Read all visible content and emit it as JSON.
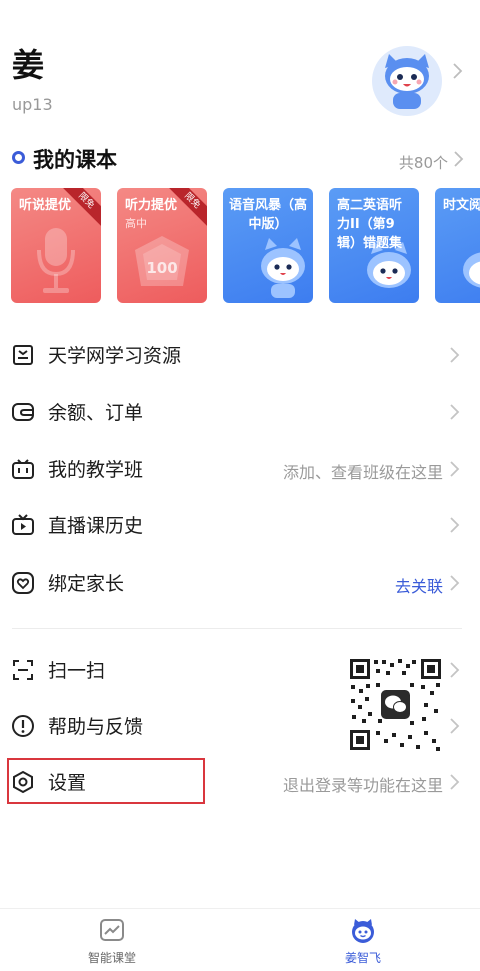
{
  "profile": {
    "name": "姜",
    "uid": "up13"
  },
  "textbooks": {
    "title": "我的课本",
    "count": "共80个",
    "items": [
      {
        "title": "听说提优",
        "subtitle": "",
        "badge": "限免",
        "color": "red"
      },
      {
        "title": "听力提优",
        "subtitle": "高中",
        "badge": "限免",
        "color": "red"
      },
      {
        "title": "语音风暴（高中版）",
        "subtitle": "",
        "badge": "",
        "color": "blue"
      },
      {
        "title": "高二英语听力II（第9辑）错题集",
        "subtitle": "",
        "badge": "",
        "color": "blue"
      },
      {
        "title": "时文阅",
        "subtitle": "",
        "badge": "",
        "color": "blue"
      }
    ],
    "score_badge": "100"
  },
  "menu": {
    "resources": {
      "label": "天学网学习资源",
      "icon": "smile-box-icon"
    },
    "orders": {
      "label": "余额、订单",
      "icon": "wallet-icon"
    },
    "classes": {
      "label": "我的教学班",
      "hint": "添加、查看班级在这里",
      "icon": "class-icon"
    },
    "live": {
      "label": "直播课历史",
      "icon": "tv-play-icon"
    },
    "parent": {
      "label": "绑定家长",
      "hint": "去关联",
      "icon": "heart-icon"
    },
    "scan": {
      "label": "扫一扫",
      "icon": "scan-icon"
    },
    "help": {
      "label": "帮助与反馈",
      "icon": "info-icon"
    },
    "settings": {
      "label": "设置",
      "hint": "退出登录等功能在这里",
      "icon": "hexagon-gear-icon"
    }
  },
  "tabbar": {
    "tabs": [
      {
        "label": "智能课堂",
        "icon": "chart-icon",
        "active": false
      },
      {
        "label": "姜智飞",
        "icon": "mascot-icon",
        "active": true
      }
    ]
  },
  "colors": {
    "accent": "#3b5cd8",
    "highlight": "#d9363e",
    "red_book": "#ee5c5d",
    "blue_book": "#3d7df0"
  }
}
